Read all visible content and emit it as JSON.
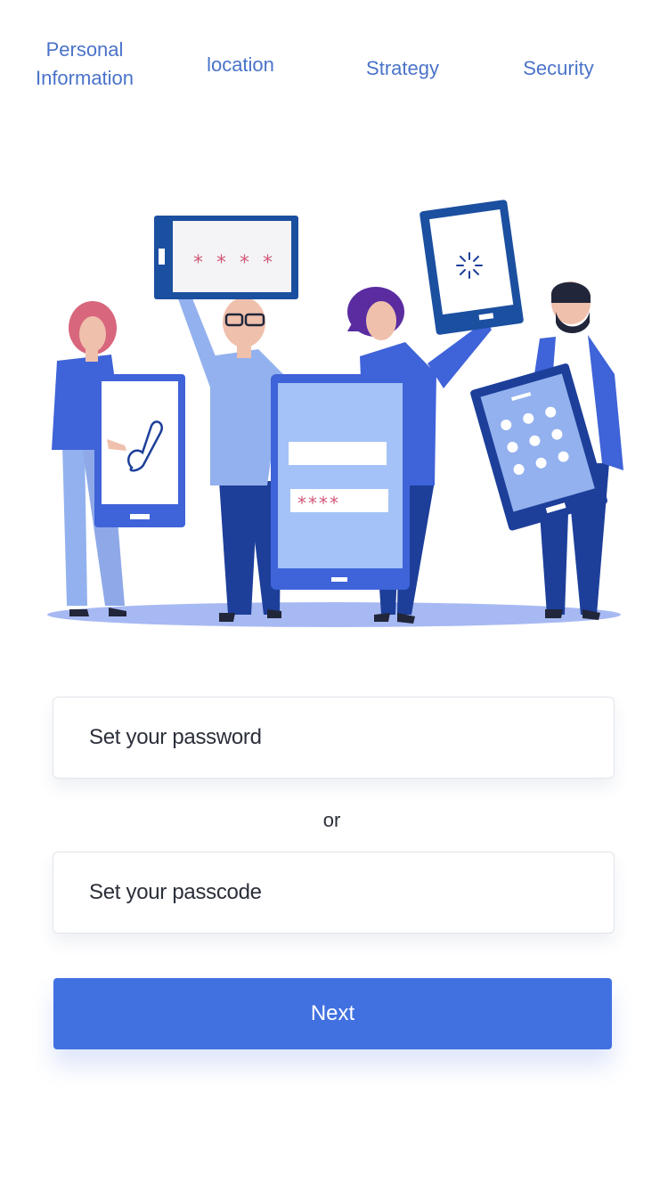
{
  "tabs": {
    "personal_line1": "Personal",
    "personal_line2": "Information",
    "location": "location",
    "strategy": "Strategy",
    "security": "Security"
  },
  "illustration": {
    "tablet_password_mask": "* * * *",
    "phone_password_mask": "****"
  },
  "form": {
    "password_placeholder": "Set your password",
    "or_label": "or",
    "passcode_placeholder": "Set your passcode"
  },
  "actions": {
    "next_label": "Next"
  },
  "colors": {
    "accent": "#4170e1",
    "tab_text": "#4a73c9",
    "text": "#2b2f3a",
    "dark_blue": "#1d3f9a",
    "mid_blue": "#3f63d8",
    "light_blue": "#93b1ee",
    "pink_asterisk": "#d35a7a"
  }
}
